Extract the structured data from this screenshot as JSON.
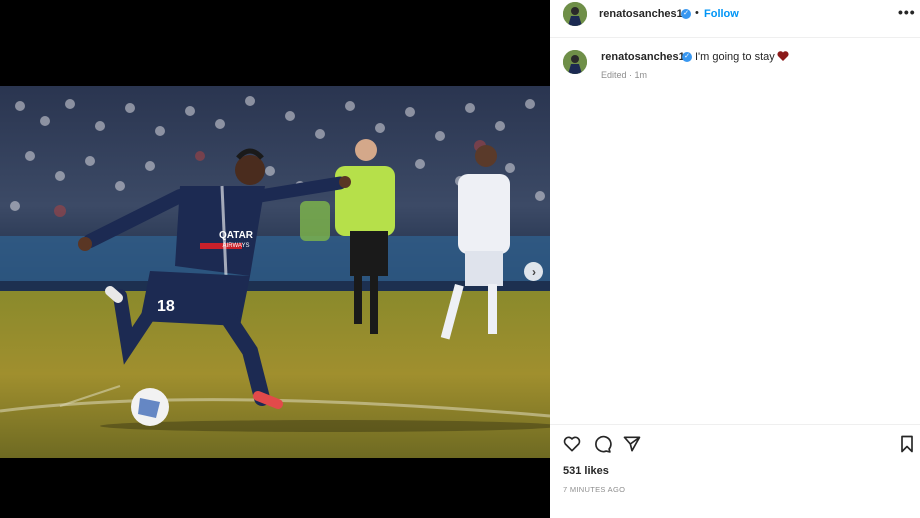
{
  "post": {
    "username": "renatosanches18",
    "verified_mark": "✓",
    "dot": "•",
    "follow_label": "Follow",
    "more_label": "•••",
    "caption_text": "I'm going to stay",
    "caption_emoji": "heart-emoji",
    "edited_label": "Edited · 1m",
    "likes": "531 likes",
    "time_ago": "7 MINUTES AGO",
    "next_label": "›",
    "photo_text": {
      "sponsor_line1": "QATAR",
      "sponsor_line2": "AIRWAYS",
      "shirt_number": "18"
    }
  },
  "colors": {
    "link": "#0095f6",
    "verified": "#3897f0",
    "meta": "#8e8e8e",
    "text": "#262626"
  },
  "icons": [
    "heart-icon",
    "comment-icon",
    "share-icon",
    "bookmark-icon",
    "next-arrow-icon",
    "more-icon"
  ]
}
